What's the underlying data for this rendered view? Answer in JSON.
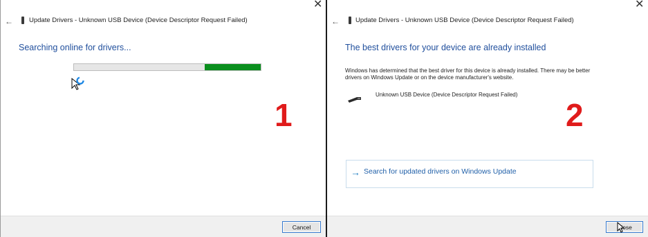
{
  "panel1": {
    "title": "Update Drivers - Unknown USB Device (Device Descriptor Request Failed)",
    "heading": "Searching online for drivers...",
    "progress": 0.3,
    "cancel_label": "Cancel",
    "step_number": "1"
  },
  "panel2": {
    "title": "Update Drivers - Unknown USB Device (Device Descriptor Request Failed)",
    "heading": "The best drivers for your device are already installed",
    "description": "Windows has determined that the best driver for this device is already installed. There may be better drivers on Windows Update or on the device manufacturer's website.",
    "device_name": "Unknown USB Device (Device Descriptor Request Failed)",
    "link_text": "Search for updated drivers on Windows Update",
    "close_label": "Close",
    "step_number": "2"
  },
  "icons": {
    "close": "close-icon",
    "back": "back-arrow-icon",
    "usb": "usb-device-icon",
    "link_arrow": "arrow-right-icon",
    "cursor": "mouse-pointer-icon",
    "busy": "busy-spinner-icon"
  },
  "colors": {
    "heading": "#1f4e9c",
    "progress": "#0a8f1e",
    "step_number": "#e01b1b",
    "link": "#1f5fa8"
  }
}
